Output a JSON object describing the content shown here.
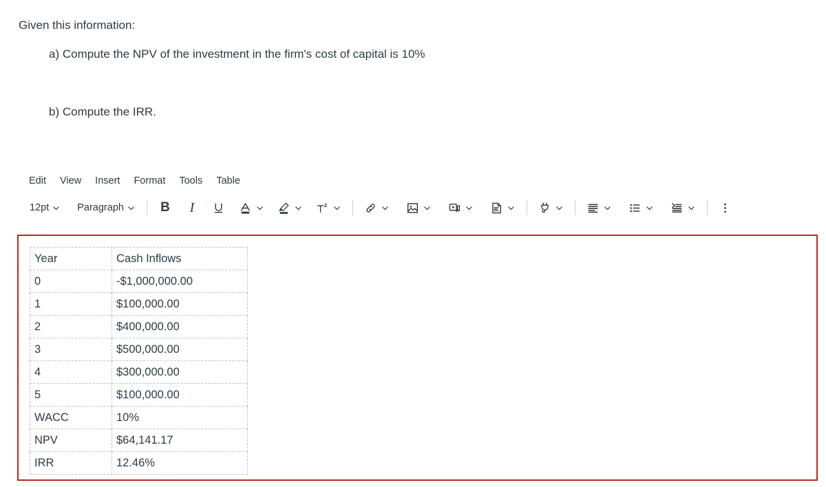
{
  "colors": {
    "text": "#2D3B45",
    "focus_ring": "#C0271B",
    "table_border": "#BFC5C9",
    "toolbar_divider": "#C7CDD1"
  },
  "prompt": {
    "intro": "Given this information:",
    "items": [
      "a) Compute the NPV of the investment in the firm's cost of capital is 10%",
      "b) Compute the IRR."
    ]
  },
  "editor": {
    "menubar": [
      {
        "label": "Edit",
        "name": "menu-edit"
      },
      {
        "label": "View",
        "name": "menu-view"
      },
      {
        "label": "Insert",
        "name": "menu-insert"
      },
      {
        "label": "Format",
        "name": "menu-format"
      },
      {
        "label": "Tools",
        "name": "menu-tools"
      },
      {
        "label": "Table",
        "name": "menu-table"
      }
    ],
    "toolbar": {
      "font_size": "12pt",
      "block_format": "Paragraph",
      "bold": "B",
      "italic": "I",
      "underline_icon": "underline-icon",
      "text_color_icon": "text-color-icon",
      "highlight_icon": "highlight-color-icon",
      "superscript_icon": "superscript-icon",
      "link_icon": "link-icon",
      "image_icon": "image-icon",
      "media_icon": "media-icon",
      "document_icon": "document-icon",
      "apps_icon": "plug-apps-icon",
      "align_icon": "align-left-icon",
      "list_icon": "bulleted-list-icon",
      "indent_icon": "indent-icon",
      "more_icon": "kebab-more-options-icon"
    }
  },
  "table_data": {
    "type": "table",
    "columns": [
      "Year",
      "Cash Inflows"
    ],
    "rows": [
      [
        "Year",
        "Cash Inflows"
      ],
      [
        "0",
        "-$1,000,000.00"
      ],
      [
        "1",
        "$100,000.00"
      ],
      [
        "2",
        "$400,000.00"
      ],
      [
        "3",
        "$500,000.00"
      ],
      [
        "4",
        "$300,000.00"
      ],
      [
        "5",
        "$100,000.00"
      ],
      [
        "WACC",
        "10%"
      ],
      [
        "NPV",
        "$64,141.17"
      ],
      [
        "IRR",
        "12.46%"
      ]
    ]
  }
}
